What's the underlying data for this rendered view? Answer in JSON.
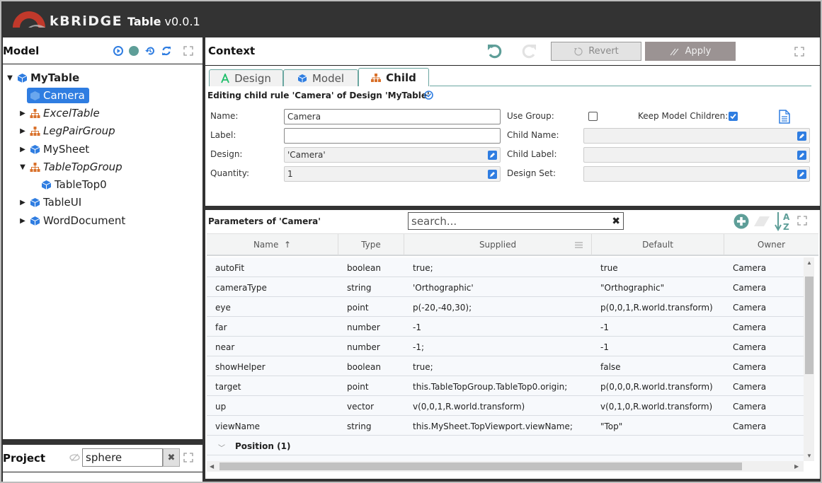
{
  "header": {
    "brand": "kBRiDGE",
    "app_name": "Table",
    "version": "v0.0.1"
  },
  "model_panel": {
    "title": "Model",
    "toolbar_icons": [
      "play-circle-icon",
      "status-dot-icon",
      "history-icon",
      "refresh-icon",
      "expand-icon"
    ],
    "status_dot_color": "#5e9e98",
    "tree": [
      {
        "label": "MyTable",
        "level": 0,
        "icon": "cube-icon",
        "expanded": true,
        "bold": true
      },
      {
        "label": "Camera",
        "level": 1,
        "icon": "cube-icon",
        "selected": true
      },
      {
        "label": "ExcelTable",
        "level": 1,
        "icon": "hierarchy-icon",
        "collapsed": true,
        "italic": true
      },
      {
        "label": "LegPairGroup",
        "level": 1,
        "icon": "hierarchy-icon",
        "collapsed": true,
        "italic": true
      },
      {
        "label": "MySheet",
        "level": 1,
        "icon": "cube-icon",
        "collapsed": true
      },
      {
        "label": "TableTopGroup",
        "level": 1,
        "icon": "hierarchy-icon",
        "expanded": true,
        "italic": true
      },
      {
        "label": "TableTop0",
        "level": 2,
        "icon": "cube-icon"
      },
      {
        "label": "TableUI",
        "level": 1,
        "icon": "cube-icon",
        "collapsed": true
      },
      {
        "label": "WordDocument",
        "level": 1,
        "icon": "cube-icon",
        "collapsed": true
      }
    ]
  },
  "project_panel": {
    "title": "Project",
    "search_value": "sphere"
  },
  "context_panel": {
    "title": "Context",
    "revert_label": "Revert",
    "apply_label": "Apply",
    "tabs": [
      {
        "label": "Design",
        "active": false
      },
      {
        "label": "Model",
        "active": false
      },
      {
        "label": "Child",
        "active": true
      }
    ],
    "caption": "Editing child rule 'Camera' of Design 'MyTable'",
    "fields": {
      "name_label": "Name:",
      "name_value": "Camera",
      "label_label": "Label:",
      "label_value": "",
      "design_label": "Design:",
      "design_value": "'Camera'",
      "quantity_label": "Quantity:",
      "quantity_value": "1",
      "use_group_label": "Use Group:",
      "use_group_checked": false,
      "keep_model_children_label": "Keep Model Children:",
      "keep_model_children_checked": true,
      "child_name_label": "Child Name:",
      "child_name_value": "",
      "child_label_label": "Child Label:",
      "child_label_value": "",
      "design_set_label": "Design Set:",
      "design_set_value": ""
    }
  },
  "params_panel": {
    "title": "Parameters of 'Camera'",
    "search_placeholder": "search...",
    "columns": [
      "Name",
      "Type",
      "Supplied",
      "Default",
      "Owner"
    ],
    "sort_indicator": "↑",
    "rows": [
      {
        "name": "autoFit",
        "type": "boolean",
        "supplied": "true;",
        "default": "true",
        "owner": "Camera"
      },
      {
        "name": "cameraType",
        "type": "string",
        "supplied": "'Orthographic'",
        "default": "\"Orthographic\"",
        "owner": "Camera"
      },
      {
        "name": "eye",
        "type": "point",
        "supplied": "p(-20,-40,30);",
        "default": "p(0,0,1,R.world.transform)",
        "owner": "Camera"
      },
      {
        "name": "far",
        "type": "number",
        "supplied": "-1",
        "default": "-1",
        "owner": "Camera"
      },
      {
        "name": "near",
        "type": "number",
        "supplied": "-1;",
        "default": "-1",
        "owner": "Camera"
      },
      {
        "name": "showHelper",
        "type": "boolean",
        "supplied": "true;",
        "default": "false",
        "owner": "Camera"
      },
      {
        "name": "target",
        "type": "point",
        "supplied": "this.TableTopGroup.TableTop0.origin;",
        "default": "p(0,0,0,R.world.transform)",
        "owner": "Camera"
      },
      {
        "name": "up",
        "type": "vector",
        "supplied": "v(0,0,1,R.world.transform)",
        "default": "v(0,1,0,R.world.transform)",
        "owner": "Camera"
      },
      {
        "name": "viewName",
        "type": "string",
        "supplied": "this.MySheet.TopViewport.viewName;",
        "default": "\"Top\"",
        "owner": "Camera"
      }
    ],
    "group_row": "Position (1)"
  },
  "colors": {
    "accent_blue": "#2f7de1",
    "teal": "#5e9e98",
    "hierarchy_orange": "#d9712b",
    "header_bg": "#333333"
  }
}
